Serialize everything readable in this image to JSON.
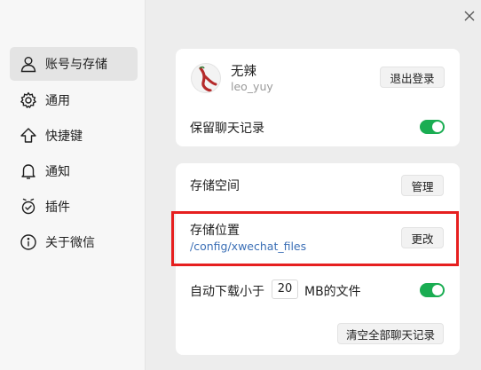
{
  "sidebar": {
    "items": [
      {
        "label": "账号与存储",
        "icon": "user-icon",
        "active": true
      },
      {
        "label": "通用",
        "icon": "gear-icon",
        "active": false
      },
      {
        "label": "快捷键",
        "icon": "shortcut-arrow-icon",
        "active": false
      },
      {
        "label": "通知",
        "icon": "bell-icon",
        "active": false
      },
      {
        "label": "插件",
        "icon": "plugin-icon",
        "active": false
      },
      {
        "label": "关于微信",
        "icon": "info-icon",
        "active": false
      }
    ]
  },
  "account": {
    "name": "无辣",
    "id": "leo_yuy",
    "logout_label": "退出登录",
    "keep_history_label": "保留聊天记录",
    "keep_history_on": true
  },
  "storage": {
    "space_label": "存储空间",
    "manage_label": "管理",
    "location_label": "存储位置",
    "location_path": "/config/xwechat_files",
    "change_label": "更改",
    "auto_download_prefix": "自动下载小于",
    "auto_download_value": "20",
    "auto_download_suffix": "MB的文件",
    "auto_download_on": true,
    "clear_label": "清空全部聊天记录"
  },
  "colors": {
    "toggle_on": "#1aad52",
    "link_blue": "#3b6fb6",
    "highlight": "#e61f1f"
  }
}
